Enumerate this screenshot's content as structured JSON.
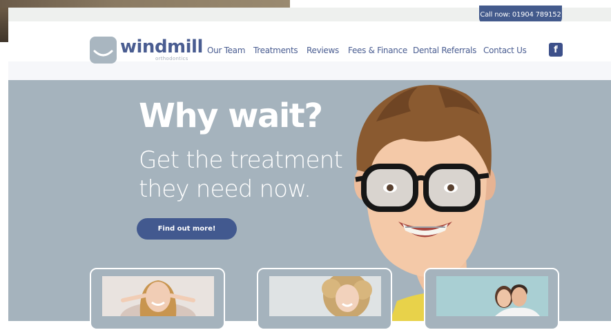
{
  "header": {
    "call_label": "Call now: 01904 789152",
    "logo_word": "windmill",
    "logo_sub": "orthodontics",
    "facebook_glyph": "f"
  },
  "nav": {
    "items": [
      {
        "label": "Our Team"
      },
      {
        "label": "Treatments"
      },
      {
        "label": "Reviews"
      },
      {
        "label": "Fees & Finance"
      },
      {
        "label": "Dental Referrals"
      },
      {
        "label": "Contact Us"
      }
    ]
  },
  "hero": {
    "title": "Why wait?",
    "subtitle_line1": "Get the treatment",
    "subtitle_line2": "they need now.",
    "cta_label": "Find out more!"
  },
  "colors": {
    "brand_blue": "#435a8c",
    "hero_bg": "#a5b3bd",
    "logo_grey": "#a9b6c0"
  },
  "icons": {
    "logo": "smile-logo-icon",
    "social": "facebook-icon"
  }
}
